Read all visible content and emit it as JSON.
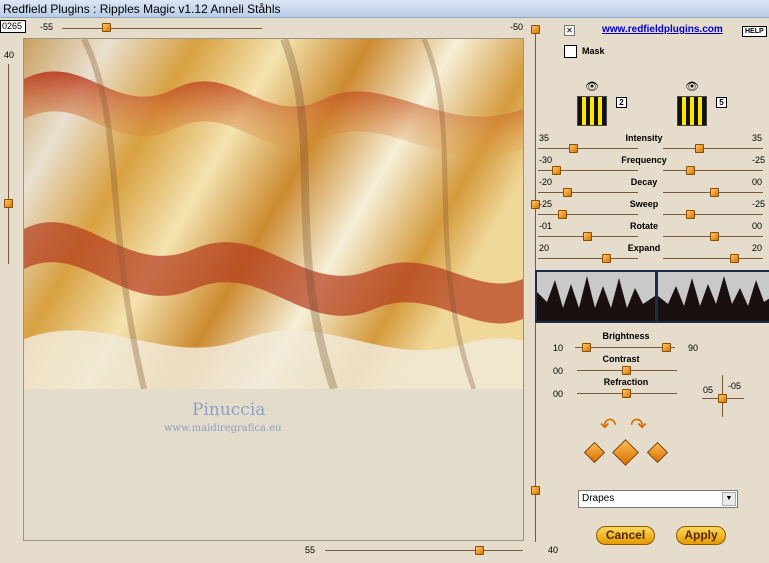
{
  "window": {
    "title": "Redfield Plugins : Ripples Magic v1.12   Anneli Ståhls"
  },
  "top_slider": {
    "left_value": "0265",
    "min_label": "-55",
    "max_label": "-50"
  },
  "left_slider": {
    "value": "40"
  },
  "bottom_slider": {
    "left_label": "55",
    "right_label": "40"
  },
  "links": {
    "website": "www.redfieldplugins.com",
    "help": "HELP"
  },
  "mask": {
    "label": "Mask",
    "checked": false
  },
  "patterns": {
    "left_badge": "2",
    "right_badge": "5"
  },
  "params": [
    {
      "name": "Intensity",
      "left": "35",
      "right": "35"
    },
    {
      "name": "Frequency",
      "left": "-30",
      "right": "-25"
    },
    {
      "name": "Decay",
      "left": "-20",
      "right": "00"
    },
    {
      "name": "Sweep",
      "left": "-25",
      "right": "-25"
    },
    {
      "name": "Rotate",
      "left": "-01",
      "right": "00"
    },
    {
      "name": "Expand",
      "left": "20",
      "right": "20"
    }
  ],
  "brightness": {
    "label": "Brightness",
    "left": "10",
    "right": "90"
  },
  "contrast": {
    "label": "Contrast",
    "value": "00"
  },
  "refraction": {
    "label": "Refraction",
    "value": "00"
  },
  "light": {
    "left": "05",
    "right": "-05"
  },
  "preset": {
    "selected": "Drapes"
  },
  "watermark": {
    "name": "Pinuccia",
    "url": "www.maidiregrafica.eu"
  },
  "buttons": {
    "cancel": "Cancel",
    "apply": "Apply"
  },
  "colors": {
    "accent": "#e59a00",
    "link": "#0000cc",
    "panel": "#e5dccb"
  }
}
